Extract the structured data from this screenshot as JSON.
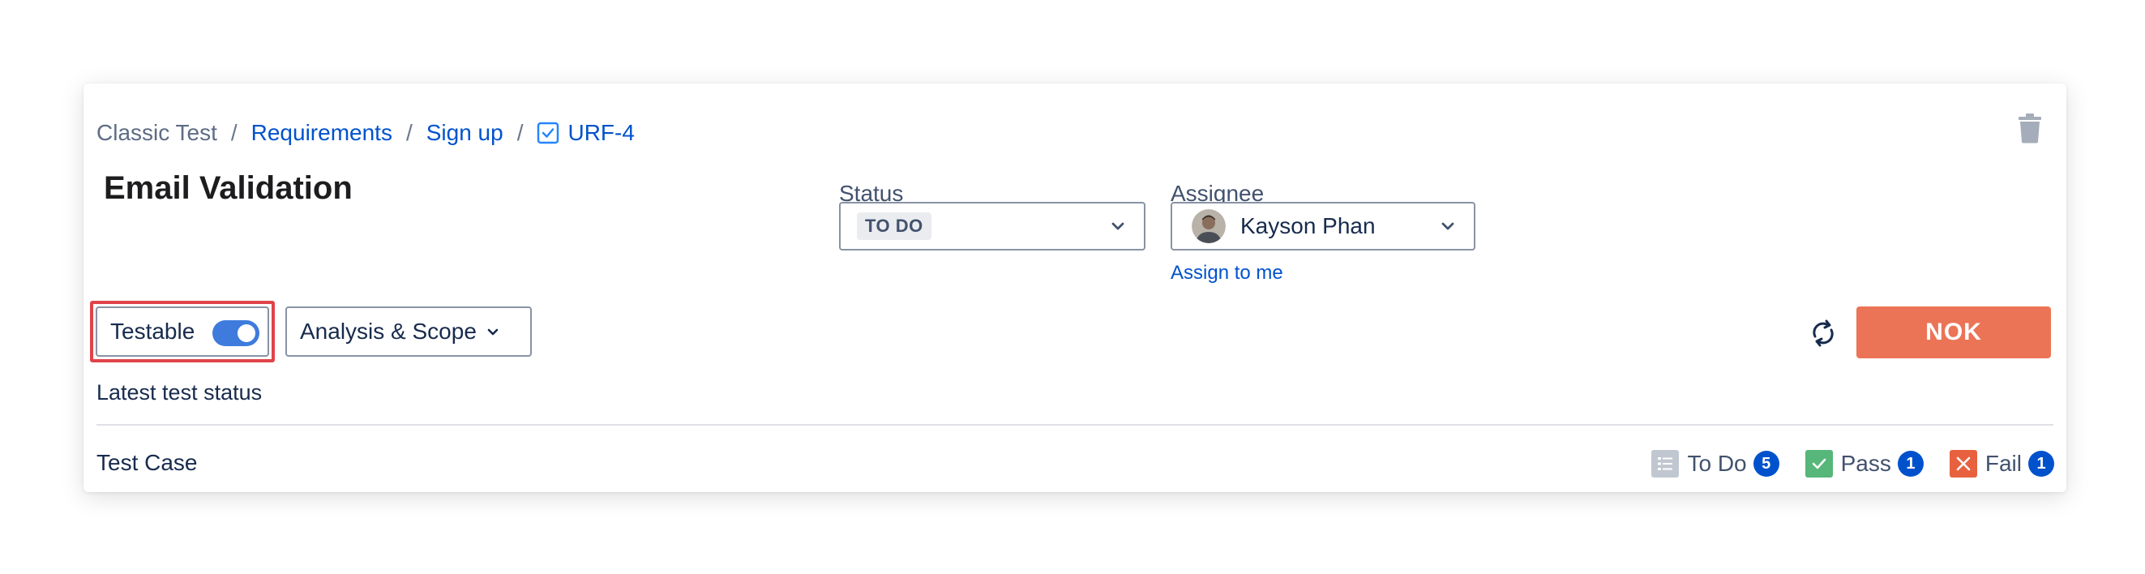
{
  "breadcrumb": {
    "project": "Classic Test",
    "requirements": "Requirements",
    "parent": "Sign up",
    "issue_key": "URF-4",
    "separator": "/"
  },
  "issue": {
    "title": "Email Validation"
  },
  "status": {
    "label": "Status",
    "value": "TO DO"
  },
  "assignee": {
    "label": "Assignee",
    "name": "Kayson Phan",
    "assign_to_me": "Assign to me"
  },
  "toolbar": {
    "testable_label": "Testable",
    "testable_on": true,
    "analysis_label": "Analysis & Scope",
    "nok_label": "NOK"
  },
  "tests": {
    "latest_status_label": "Latest test status",
    "test_case_label": "Test Case",
    "counts": [
      {
        "label": "To Do",
        "count": "5",
        "color": "#c1c7d0"
      },
      {
        "label": "Pass",
        "count": "1",
        "color": "#57b679"
      },
      {
        "label": "Fail",
        "count": "1",
        "color": "#e8613f"
      }
    ]
  },
  "colors": {
    "accent": "#0052cc",
    "nok": "#ec7456",
    "toggle": "#3e7bdc",
    "highlight": "#e0434a"
  },
  "icons": {
    "trash": "trash-icon",
    "checkbox": "checkbox-icon",
    "sync": "sync-icon",
    "chevron": "chevron-down-icon"
  }
}
